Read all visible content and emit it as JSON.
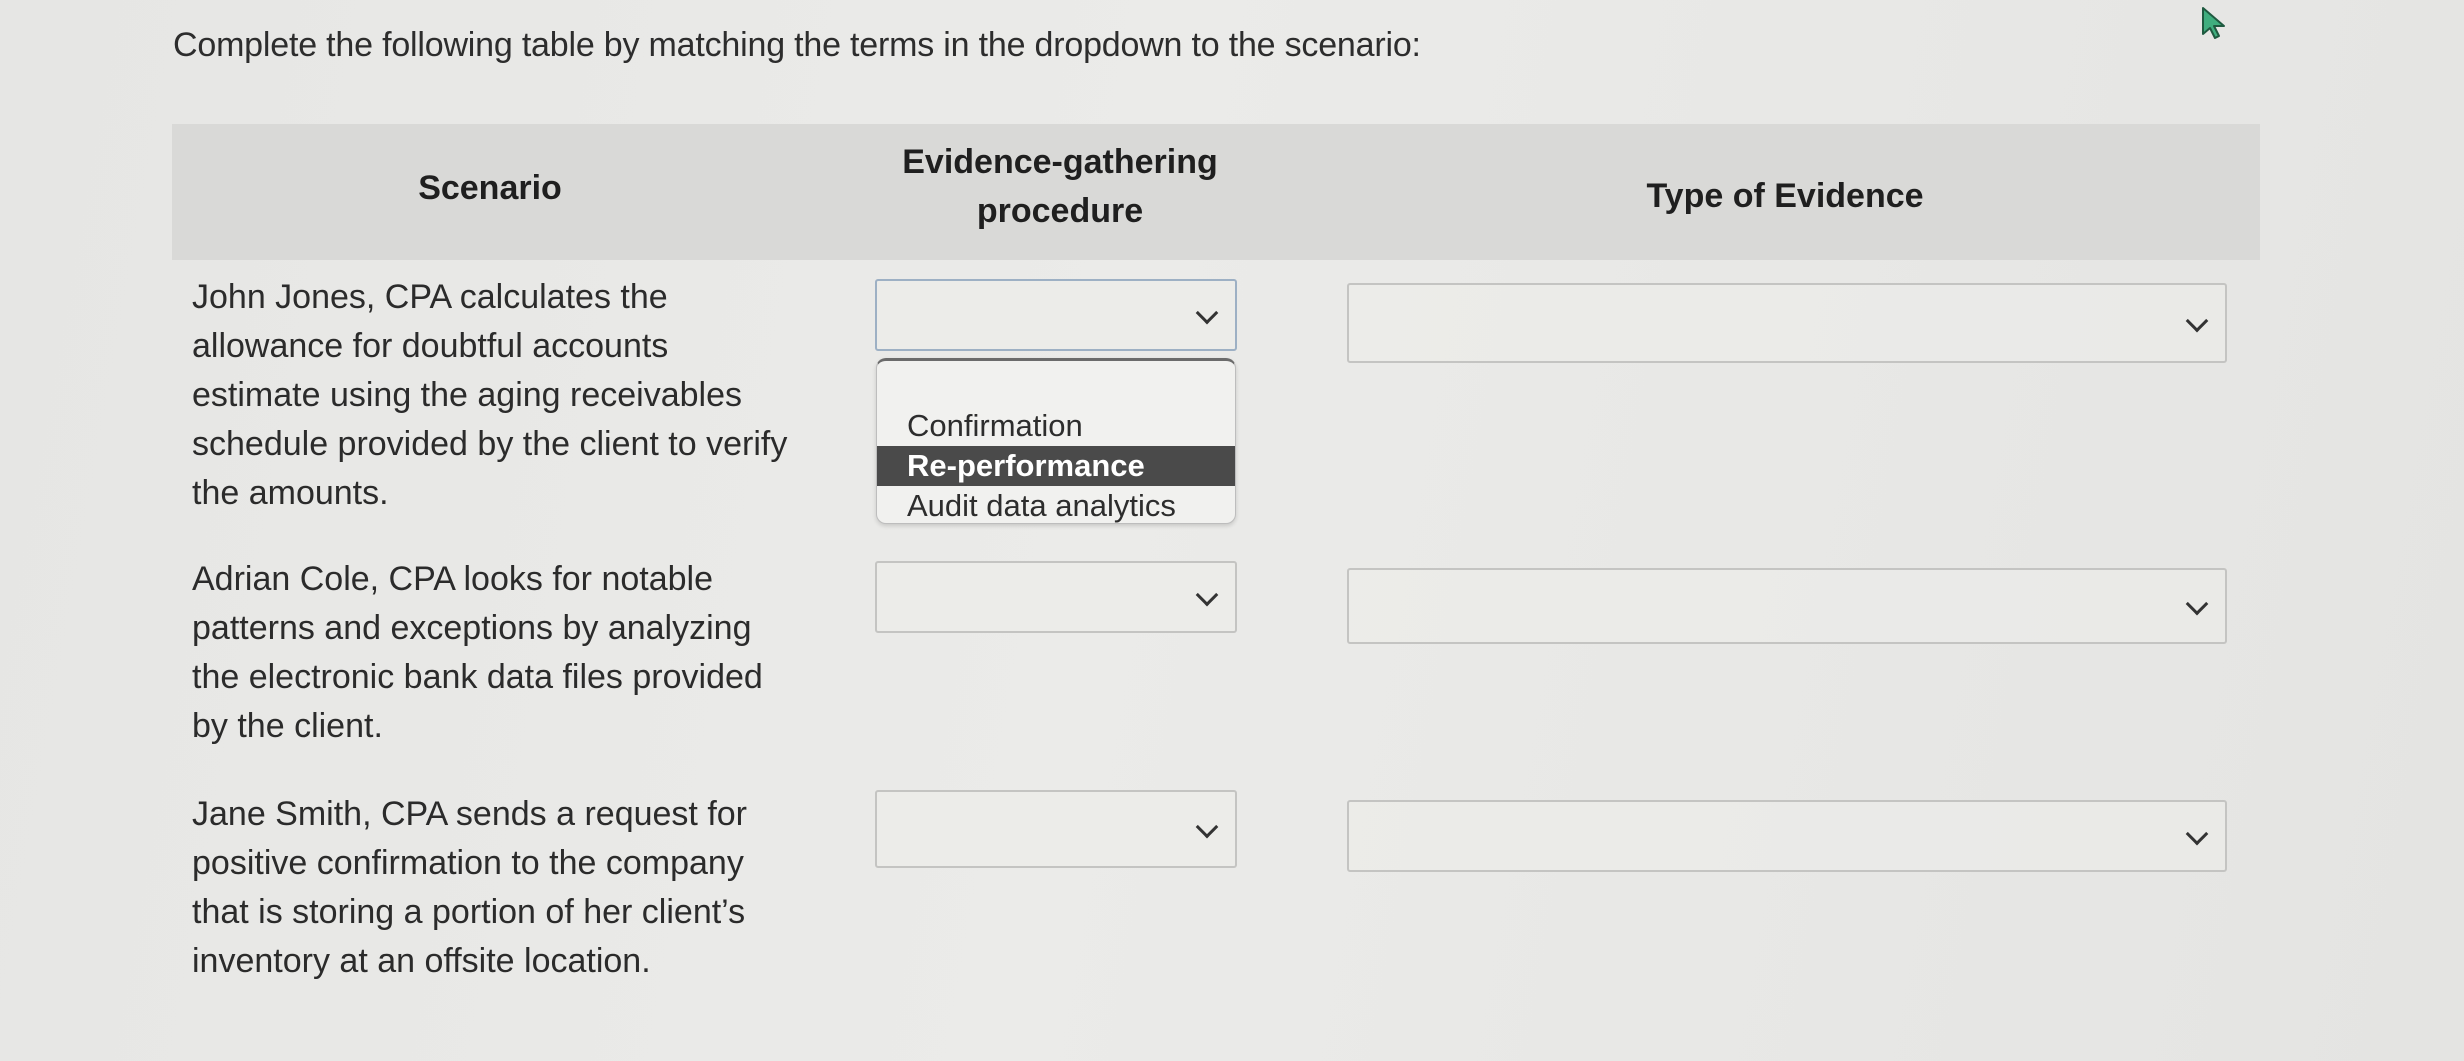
{
  "instructions": "Complete the following table by matching the terms in the dropdown to the scenario:",
  "table": {
    "headers": {
      "scenario": "Scenario",
      "procedure": "Evidence-gathering procedure",
      "type": "Type of Evidence"
    },
    "rows": [
      {
        "scenario": "John Jones, CPA calculates the allowance for doubtful accounts estimate using the aging receivables schedule provided by the client to verify the amounts.",
        "procedure_value": "",
        "type_value": ""
      },
      {
        "scenario": "Adrian Cole, CPA looks for notable patterns and exceptions by analyzing the electronic bank data files provided by the client.",
        "procedure_value": "",
        "type_value": ""
      },
      {
        "scenario": "Jane Smith, CPA sends a request for positive confirmation to the company that is storing a portion of her client’s inventory at an offsite location.",
        "procedure_value": "",
        "type_value": ""
      }
    ]
  },
  "open_dropdown": {
    "row": 1,
    "column": "Evidence-gathering procedure",
    "options": [
      "Confirmation",
      "Re-performance",
      "Audit data analytics"
    ],
    "highlighted": "Re-performance"
  },
  "icons": {
    "chevron": "chevron-down-icon",
    "cursor": "mouse-pointer-icon"
  },
  "colors": {
    "header_band": "#d9d9d7",
    "highlight": "#4a4a4a",
    "cursor": "#3fae7e"
  }
}
